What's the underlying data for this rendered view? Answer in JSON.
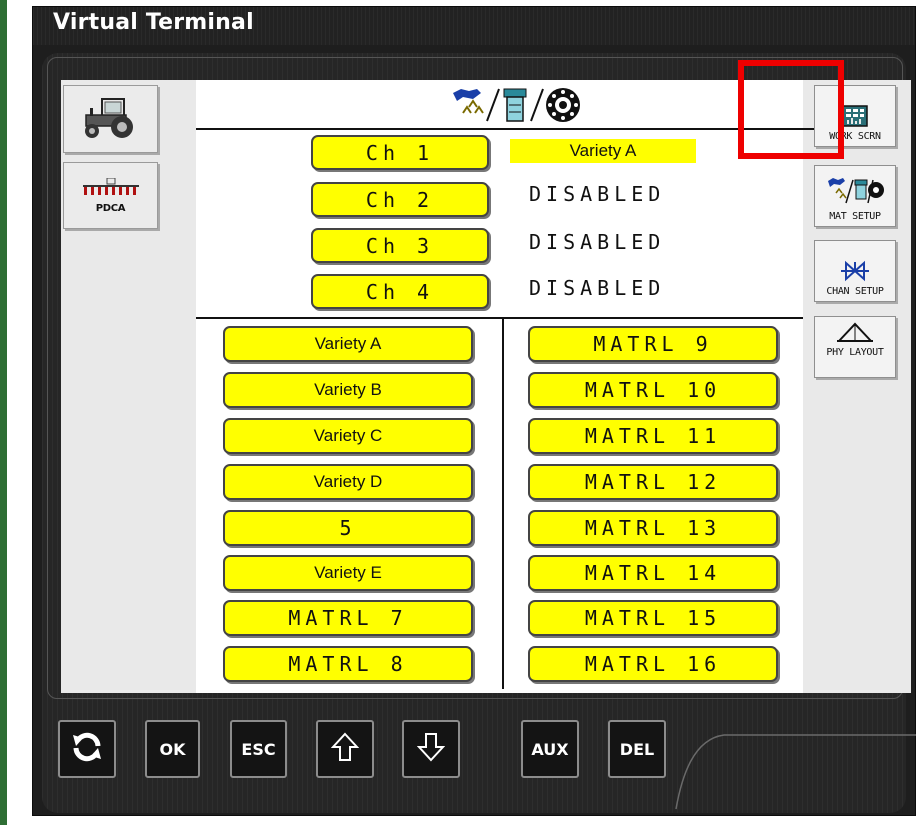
{
  "window": {
    "title": "Virtual Terminal"
  },
  "left_softkeys": [
    {
      "name": "tractor-home",
      "icon": "tractor-icon",
      "label": ""
    },
    {
      "name": "pdca",
      "icon": "planter-icon",
      "label": "PDCA"
    }
  ],
  "right_softkeys": [
    {
      "name": "work-screen",
      "icon": "work-screen-icon",
      "label": "WORK SCRN",
      "highlighted": true
    },
    {
      "name": "mat-setup",
      "icon": "material-setup-icon",
      "label": "MAT SETUP"
    },
    {
      "name": "chan-setup",
      "icon": "valve-icon",
      "label": "CHAN SETUP"
    },
    {
      "name": "phy-layout",
      "icon": "layout-triangle-icon",
      "label": "PHY LAYOUT"
    }
  ],
  "header": {
    "icon": "material-setup-icon"
  },
  "channels": [
    {
      "label": "Ch 1",
      "status": "Variety A",
      "highlighted": true
    },
    {
      "label": "Ch 2",
      "status": "DISABLED",
      "highlighted": false
    },
    {
      "label": "Ch 3",
      "status": "DISABLED",
      "highlighted": false
    },
    {
      "label": "Ch 4",
      "status": "DISABLED",
      "highlighted": false
    }
  ],
  "materials_left": [
    "Variety A",
    "Variety B",
    "Variety C",
    "Variety D",
    "5",
    "Variety E",
    "MATRL 7",
    "MATRL 8"
  ],
  "materials_right": [
    "MATRL 9",
    "MATRL 10",
    "MATRL 11",
    "MATRL 12",
    "MATRL 13",
    "MATRL 14",
    "MATRL 15",
    "MATRL 16"
  ],
  "bottom_keys": [
    {
      "name": "refresh",
      "label": "",
      "icon": "refresh-icon"
    },
    {
      "name": "ok",
      "label": "OK",
      "icon": ""
    },
    {
      "name": "esc",
      "label": "ESC",
      "icon": ""
    },
    {
      "name": "up",
      "label": "",
      "icon": "arrow-up-icon"
    },
    {
      "name": "down",
      "label": "",
      "icon": "arrow-down-icon"
    },
    {
      "name": "aux",
      "label": "AUX",
      "icon": ""
    },
    {
      "name": "del",
      "label": "DEL",
      "icon": ""
    }
  ],
  "colors": {
    "button": "#ffff00",
    "highlight": "#ffff00",
    "selection_box": "#ee0000",
    "window_frame": "#1e1e1e",
    "accent_green": "#2e6e34"
  }
}
